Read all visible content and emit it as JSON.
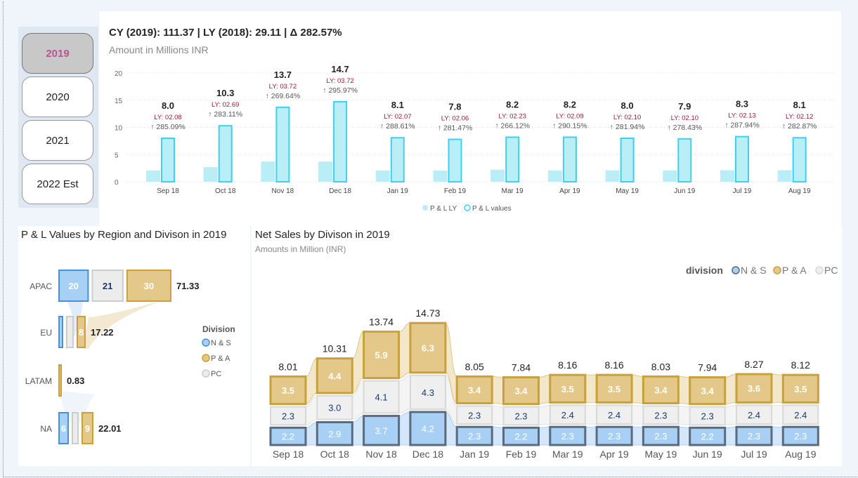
{
  "years": {
    "items": [
      "2019",
      "2020",
      "2021",
      "2022 Est"
    ],
    "selected": "2019"
  },
  "top_chart": {
    "title": "CY (2019): 111.37 | LY (2018): 29.11 | Δ 282.57%",
    "subtitle": "Amount in Millions INR",
    "legend": [
      "P & L LY",
      "P & L values"
    ],
    "colors": {
      "ly": "#b9eef7",
      "cy": "#b9eef7",
      "cy_border": "#3fd0ef",
      "ly_label": "#9b1b30"
    }
  },
  "left_chart": {
    "title": "P & L Values by Region and Divison in 2019",
    "legend_title": "Division",
    "legend": [
      "N & S",
      "P & A",
      "PC"
    ],
    "colors": {
      "ns": "#a8d0f5",
      "ns_border": "#4a90d9",
      "pa": "#e3c88a",
      "pa_border": "#c9a13c",
      "pc": "#ececec",
      "pc_border": "#cccccc"
    }
  },
  "right_chart": {
    "title": "Net Sales by Divison in 2019",
    "subtitle": "Amounts in Million (INR)",
    "legend_title": "division",
    "legend": [
      "N & S",
      "P & A",
      "PC"
    ]
  },
  "chart_data": [
    {
      "type": "bar",
      "title": "CY (2019): 111.37 | LY (2018): 29.11 | Δ 282.57%",
      "subtitle": "Amount in Millions INR",
      "categories": [
        "Sep 18",
        "Oct 18",
        "Nov 18",
        "Dec 18",
        "Jan 19",
        "Feb 19",
        "Mar 19",
        "Apr 19",
        "May 19",
        "Jun 19",
        "Jul 19",
        "Aug 19"
      ],
      "series": [
        {
          "name": "P & L LY",
          "values": [
            2.08,
            2.69,
            3.72,
            3.72,
            2.07,
            2.06,
            2.23,
            2.09,
            2.1,
            2.1,
            2.13,
            2.12
          ]
        },
        {
          "name": "P & L values",
          "values": [
            8.0,
            10.3,
            13.7,
            14.7,
            8.1,
            7.8,
            8.2,
            8.2,
            8.0,
            7.9,
            8.3,
            8.1
          ]
        }
      ],
      "value_labels": [
        "8.0",
        "10.3",
        "13.7",
        "14.7",
        "8.1",
        "7.8",
        "8.2",
        "8.2",
        "8.0",
        "7.9",
        "8.3",
        "8.1"
      ],
      "ly_labels": [
        "LY: 02.08",
        "LY: 02.69",
        "LY: 03.72",
        "LY: 03.72",
        "LY: 02.07",
        "LY: 02.06",
        "LY: 02.23",
        "LY: 02.09",
        "LY: 02.10",
        "LY: 02.10",
        "LY: 02.13",
        "LY: 02.12"
      ],
      "change_labels": [
        "↑ 285.09%",
        "↑ 283.11%",
        "↑ 269.64%",
        "↑ 295.97%",
        "↑ 288.61%",
        "↑ 281.47%",
        "↑ 266.12%",
        "↑ 290.15%",
        "↑ 281.94%",
        "↑ 278.43%",
        "↑ 287.94%",
        "↑ 282.87%"
      ],
      "yticks": [
        0,
        5,
        10,
        15,
        20
      ],
      "ylim": [
        0,
        20
      ],
      "grid": true,
      "legend_position": "bottom"
    },
    {
      "type": "bar",
      "title": "P & L Values by Region and Divison in 2019",
      "categories": [
        "APAC",
        "EU",
        "LATAM",
        "NA"
      ],
      "series": [
        {
          "name": "N & S",
          "values": [
            20,
            1,
            0,
            6
          ]
        },
        {
          "name": "PC",
          "values": [
            21,
            0.5,
            0,
            1
          ]
        },
        {
          "name": "P & A",
          "values": [
            30,
            8,
            0.83,
            9
          ]
        }
      ],
      "value_labels": {
        "APAC": [
          "20",
          "21",
          "30"
        ],
        "EU": [
          "",
          "",
          "8"
        ],
        "LATAM": [
          "",
          "",
          ""
        ],
        "NA": [
          "6",
          "",
          "9"
        ]
      },
      "totals": [
        "71.33",
        "17.22",
        "0.83",
        "22.01"
      ],
      "legend_position": "right"
    },
    {
      "type": "bar",
      "title": "Net Sales by Divison in 2019",
      "subtitle": "Amounts in Million (INR)",
      "stacked": true,
      "categories": [
        "Sep 18",
        "Oct 18",
        "Nov 18",
        "Dec 18",
        "Jan 19",
        "Feb 19",
        "Mar 19",
        "Apr 19",
        "May 19",
        "Jun 19",
        "Jul 19",
        "Aug 19"
      ],
      "series": [
        {
          "name": "N & S",
          "values": [
            2.2,
            2.9,
            3.7,
            4.2,
            2.3,
            2.2,
            2.3,
            2.3,
            2.3,
            2.2,
            2.3,
            2.3
          ]
        },
        {
          "name": "PC",
          "values": [
            2.3,
            3.0,
            4.1,
            4.3,
            2.3,
            2.3,
            2.4,
            2.4,
            2.3,
            2.3,
            2.4,
            2.4
          ]
        },
        {
          "name": "P & A",
          "values": [
            3.5,
            4.4,
            5.9,
            6.3,
            3.4,
            3.4,
            3.5,
            3.5,
            3.4,
            3.4,
            3.6,
            3.5
          ]
        }
      ],
      "totals": [
        "8.01",
        "10.31",
        "13.74",
        "14.73",
        "8.05",
        "7.84",
        "8.16",
        "8.16",
        "8.03",
        "7.94",
        "8.27",
        "8.12"
      ],
      "legend_position": "top-right"
    }
  ]
}
